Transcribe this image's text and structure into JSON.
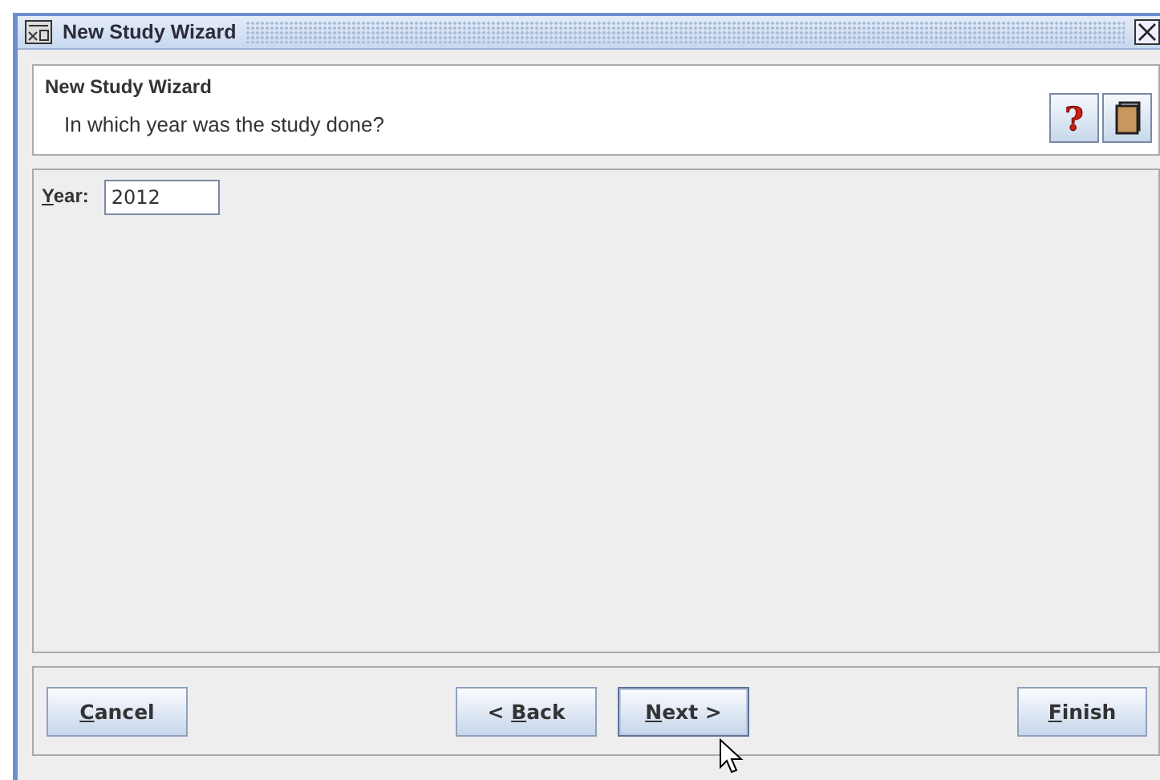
{
  "window": {
    "title": "New Study Wizard"
  },
  "header": {
    "title": "New Study Wizard",
    "subtitle": "In which year was the study done?",
    "buttons": [
      {
        "kind": "help",
        "label": "?"
      },
      {
        "kind": "book"
      }
    ]
  },
  "field": {
    "label": {
      "key": "Y",
      "after": "ear:"
    },
    "value": "2012"
  },
  "buttons": [
    {
      "key": "C",
      "after": "ancel",
      "focused": false,
      "kind": "left"
    },
    {
      "before": "< ",
      "key": "B",
      "after": "ack",
      "focused": false,
      "kind": "middle"
    },
    {
      "key": "N",
      "after": "ext >",
      "focused": true,
      "kind": "middle"
    },
    {
      "key": "F",
      "after": "inish",
      "focused": false,
      "kind": "right"
    }
  ]
}
